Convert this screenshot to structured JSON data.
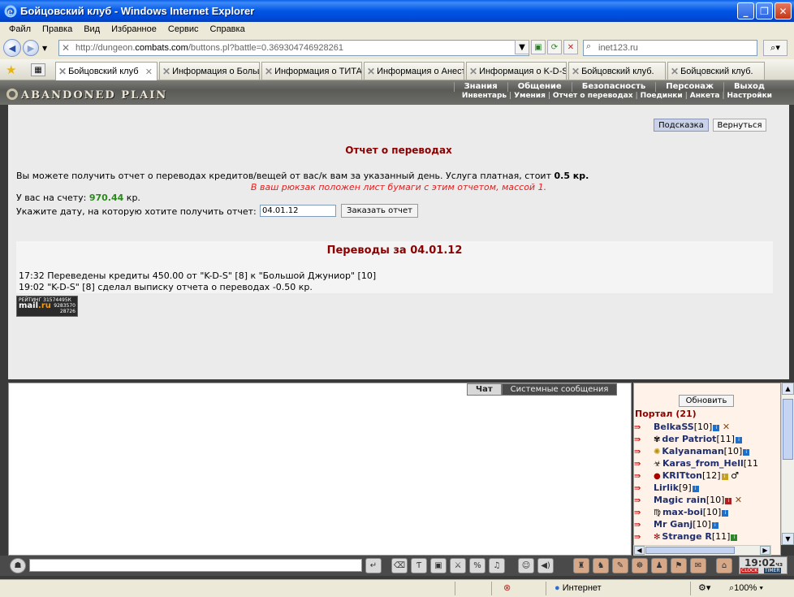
{
  "window": {
    "title": "Бойцовский клуб - Windows Internet Explorer"
  },
  "menubar": [
    "Файл",
    "Правка",
    "Вид",
    "Избранное",
    "Сервис",
    "Справка"
  ],
  "address": {
    "url_prefix": "http://dungeon.",
    "url_domain": "combats.com",
    "url_rest": "/buttons.pl?battle=0.369304746928261"
  },
  "search": {
    "placeholder": "inet123.ru"
  },
  "tabs": [
    {
      "label": "Бойцовский клуб",
      "active": true
    },
    {
      "label": "Информация о Больш...",
      "active": false
    },
    {
      "label": "Информация о ТИТАН",
      "active": false
    },
    {
      "label": "Информация о Анест...",
      "active": false
    },
    {
      "label": "Информация о K-D-S",
      "active": false
    },
    {
      "label": "Бойцовский клуб.",
      "active": false
    },
    {
      "label": "Бойцовский клуб.",
      "active": false
    }
  ],
  "game": {
    "logo": "ABANDONED PLAIN",
    "main_menu": [
      "Знания",
      "Общение",
      "Безопасность",
      "Персонаж",
      "Выход"
    ],
    "sub_menu": [
      "Инвентарь",
      "Умения",
      "Отчет о переводах",
      "Поединки",
      "Анкета",
      "Настройки"
    ]
  },
  "report": {
    "hint_btn": "Подсказка",
    "back_btn": "Вернуться",
    "title": "Отчет о переводах",
    "desc_prefix": "Вы можете получить отчет о переводах кредитов/вещей от вас/к вам за указанный день. Услуга платная, стоит ",
    "desc_price": "0.5 кр.",
    "notice": "В ваш рюкзак положен лист бумаги с этим отчетом, массой 1.",
    "balance_label": "У вас на счету: ",
    "balance_value": "970.44",
    "balance_unit": " кр.",
    "date_label": "Укажите дату, на которую хотите получить отчет:",
    "date_value": "04.01.12",
    "order_btn": "Заказать отчет",
    "transfers_title": "Переводы за 04.01.12",
    "transfers": [
      "17:32 Переведены кредиты 450.00 от \"K-D-S\" [8] к \"Большой Джуниор\" [10]",
      "19:02 \"K-D-S\" [8] сделал выписку отчета о переводах -0.50 кр."
    ]
  },
  "counter": {
    "line1": "РЕЙТИНГ 31574495К",
    "line2": "9283570",
    "line3": "28726",
    "brand_a": "mail",
    "brand_b": ".ru"
  },
  "chat": {
    "tab_chat": "Чат",
    "tab_system": "Системные сообщения"
  },
  "side": {
    "refresh_btn": "Обновить",
    "portal_title": "Портал (21)",
    "users": [
      {
        "name": "BelkaSS",
        "level": "[10]",
        "indent": false
      },
      {
        "name": "der Patriot",
        "level": "[11]",
        "indent": true
      },
      {
        "name": "Kalyanaman",
        "level": "[10]",
        "indent": true
      },
      {
        "name": "Karas_from_Hell",
        "level": "[11",
        "indent": true
      },
      {
        "name": "KRITton",
        "level": "[12]",
        "indent": true
      },
      {
        "name": "Lirlik",
        "level": "[9]",
        "indent": false
      },
      {
        "name": "Magic rain",
        "level": "[10]",
        "indent": false
      },
      {
        "name": "max-boi",
        "level": "[10]",
        "indent": true
      },
      {
        "name": "Mr Ganj",
        "level": "[10]",
        "indent": false
      },
      {
        "name": "Strange R",
        "level": "[11]",
        "indent": true
      }
    ]
  },
  "clock": {
    "time": "19:02",
    "unit": "чз",
    "label_a": "CLOCK",
    "label_b": "TIMER"
  },
  "statusbar": {
    "zone": "Интернет",
    "zoom": "100%"
  }
}
